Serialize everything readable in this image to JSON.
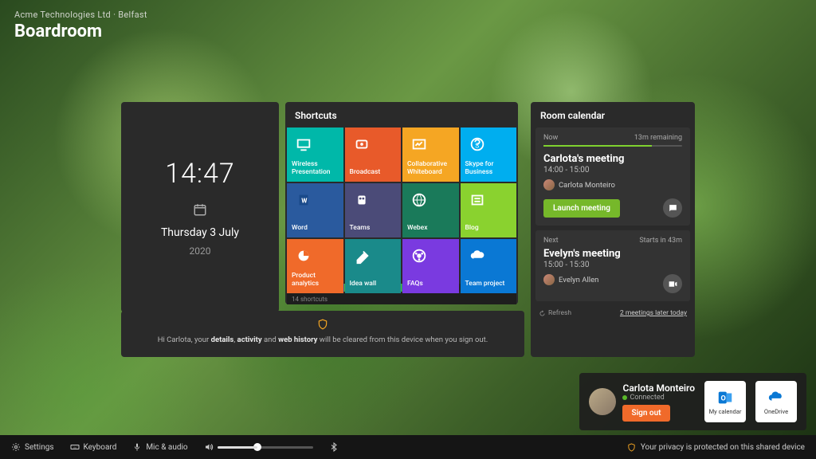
{
  "header": {
    "org": "Acme Technologies Ltd",
    "loc": "Belfast",
    "room": "Boardroom"
  },
  "clock": {
    "time": "14:47",
    "day": "Thursday 3 July",
    "year": "2020"
  },
  "shortcuts": {
    "title": "Shortcuts",
    "count_label": "14 shortcuts",
    "tiles": [
      {
        "label": "Wireless Presentation",
        "color": "#00b8a9"
      },
      {
        "label": "Broadcast",
        "color": "#e85a2a"
      },
      {
        "label": "Collaborative Whiteboard",
        "color": "#f5a623"
      },
      {
        "label": "Skype for Business",
        "color": "#00aeef"
      },
      {
        "label": "Word",
        "color": "#2a5a9e"
      },
      {
        "label": "Teams",
        "color": "#4b4b78"
      },
      {
        "label": "Webex",
        "color": "#1a7a5a"
      },
      {
        "label": "Blog",
        "color": "#8ad22f"
      },
      {
        "label": "Product analytics",
        "color": "#f06a2a"
      },
      {
        "label": "Idea wall",
        "color": "#1a8a8a"
      },
      {
        "label": "FAQs",
        "color": "#7a3ae0"
      },
      {
        "label": "Team project",
        "color": "#0a78d4"
      }
    ]
  },
  "calendar": {
    "title": "Room calendar",
    "now": {
      "label": "Now",
      "remaining": "13m remaining",
      "title": "Carlota's meeting",
      "time": "14:00 - 15:00",
      "organizer": "Carlota Monteiro",
      "launch": "Launch meeting"
    },
    "next": {
      "label": "Next",
      "starts": "Starts in 43m",
      "title": "Evelyn's meeting",
      "time": "15:00 - 15:30",
      "organizer": "Evelyn Allen"
    },
    "refresh": "Refresh",
    "later": "2 meetings later today"
  },
  "privacy": {
    "pre": "Hi Carlota, your ",
    "b1": "details",
    "m1": ", ",
    "b2": "activity",
    "m2": " and ",
    "b3": "web history",
    "post": " will be cleared from this device when you sign out."
  },
  "user": {
    "name": "Carlota Monteiro",
    "status": "Connected",
    "signout": "Sign out",
    "link1": "My calendar",
    "link2": "OneDrive"
  },
  "taskbar": {
    "settings": "Settings",
    "keyboard": "Keyboard",
    "mic": "Mic & audio",
    "privacy": "Your privacy is protected on this shared device"
  }
}
